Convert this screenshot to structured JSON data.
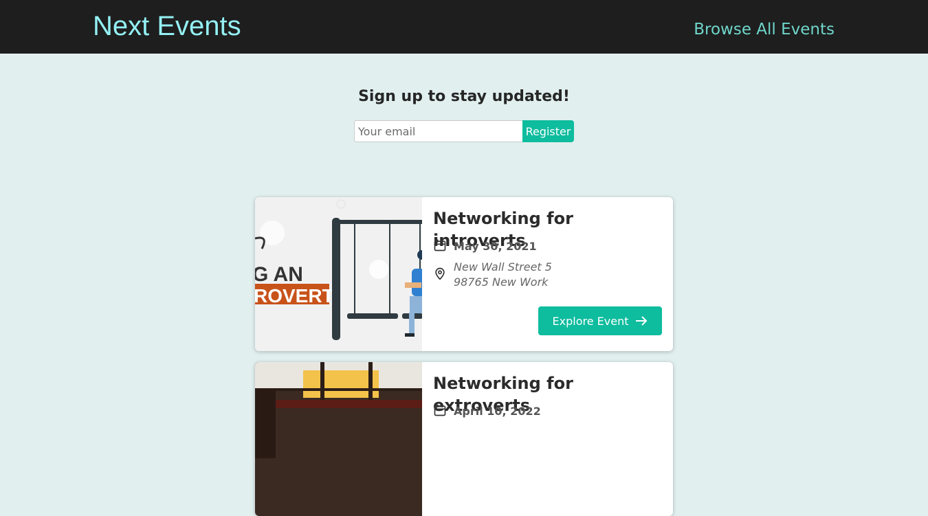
{
  "header": {
    "logo": "Next Events",
    "nav_link": "Browse All Events"
  },
  "signup": {
    "title": "Sign up to stay updated!",
    "email_placeholder": "Your email",
    "register_label": "Register"
  },
  "events": [
    {
      "title": "Networking for introverts",
      "date": "May 30, 2021",
      "address_line1": "New Wall Street 5",
      "address_line2": "98765 New Work",
      "button_label": "Explore Event",
      "image_text_1": "G AN",
      "image_text_2": "ROVERT"
    },
    {
      "title": "Networking for extroverts",
      "date": "April 10, 2022"
    }
  ],
  "colors": {
    "header_bg": "#1e1e1e",
    "logo": "#94f0f4",
    "nav_link": "#6fd6cb",
    "page_bg": "#e1efef",
    "accent": "#0ebc9e"
  }
}
